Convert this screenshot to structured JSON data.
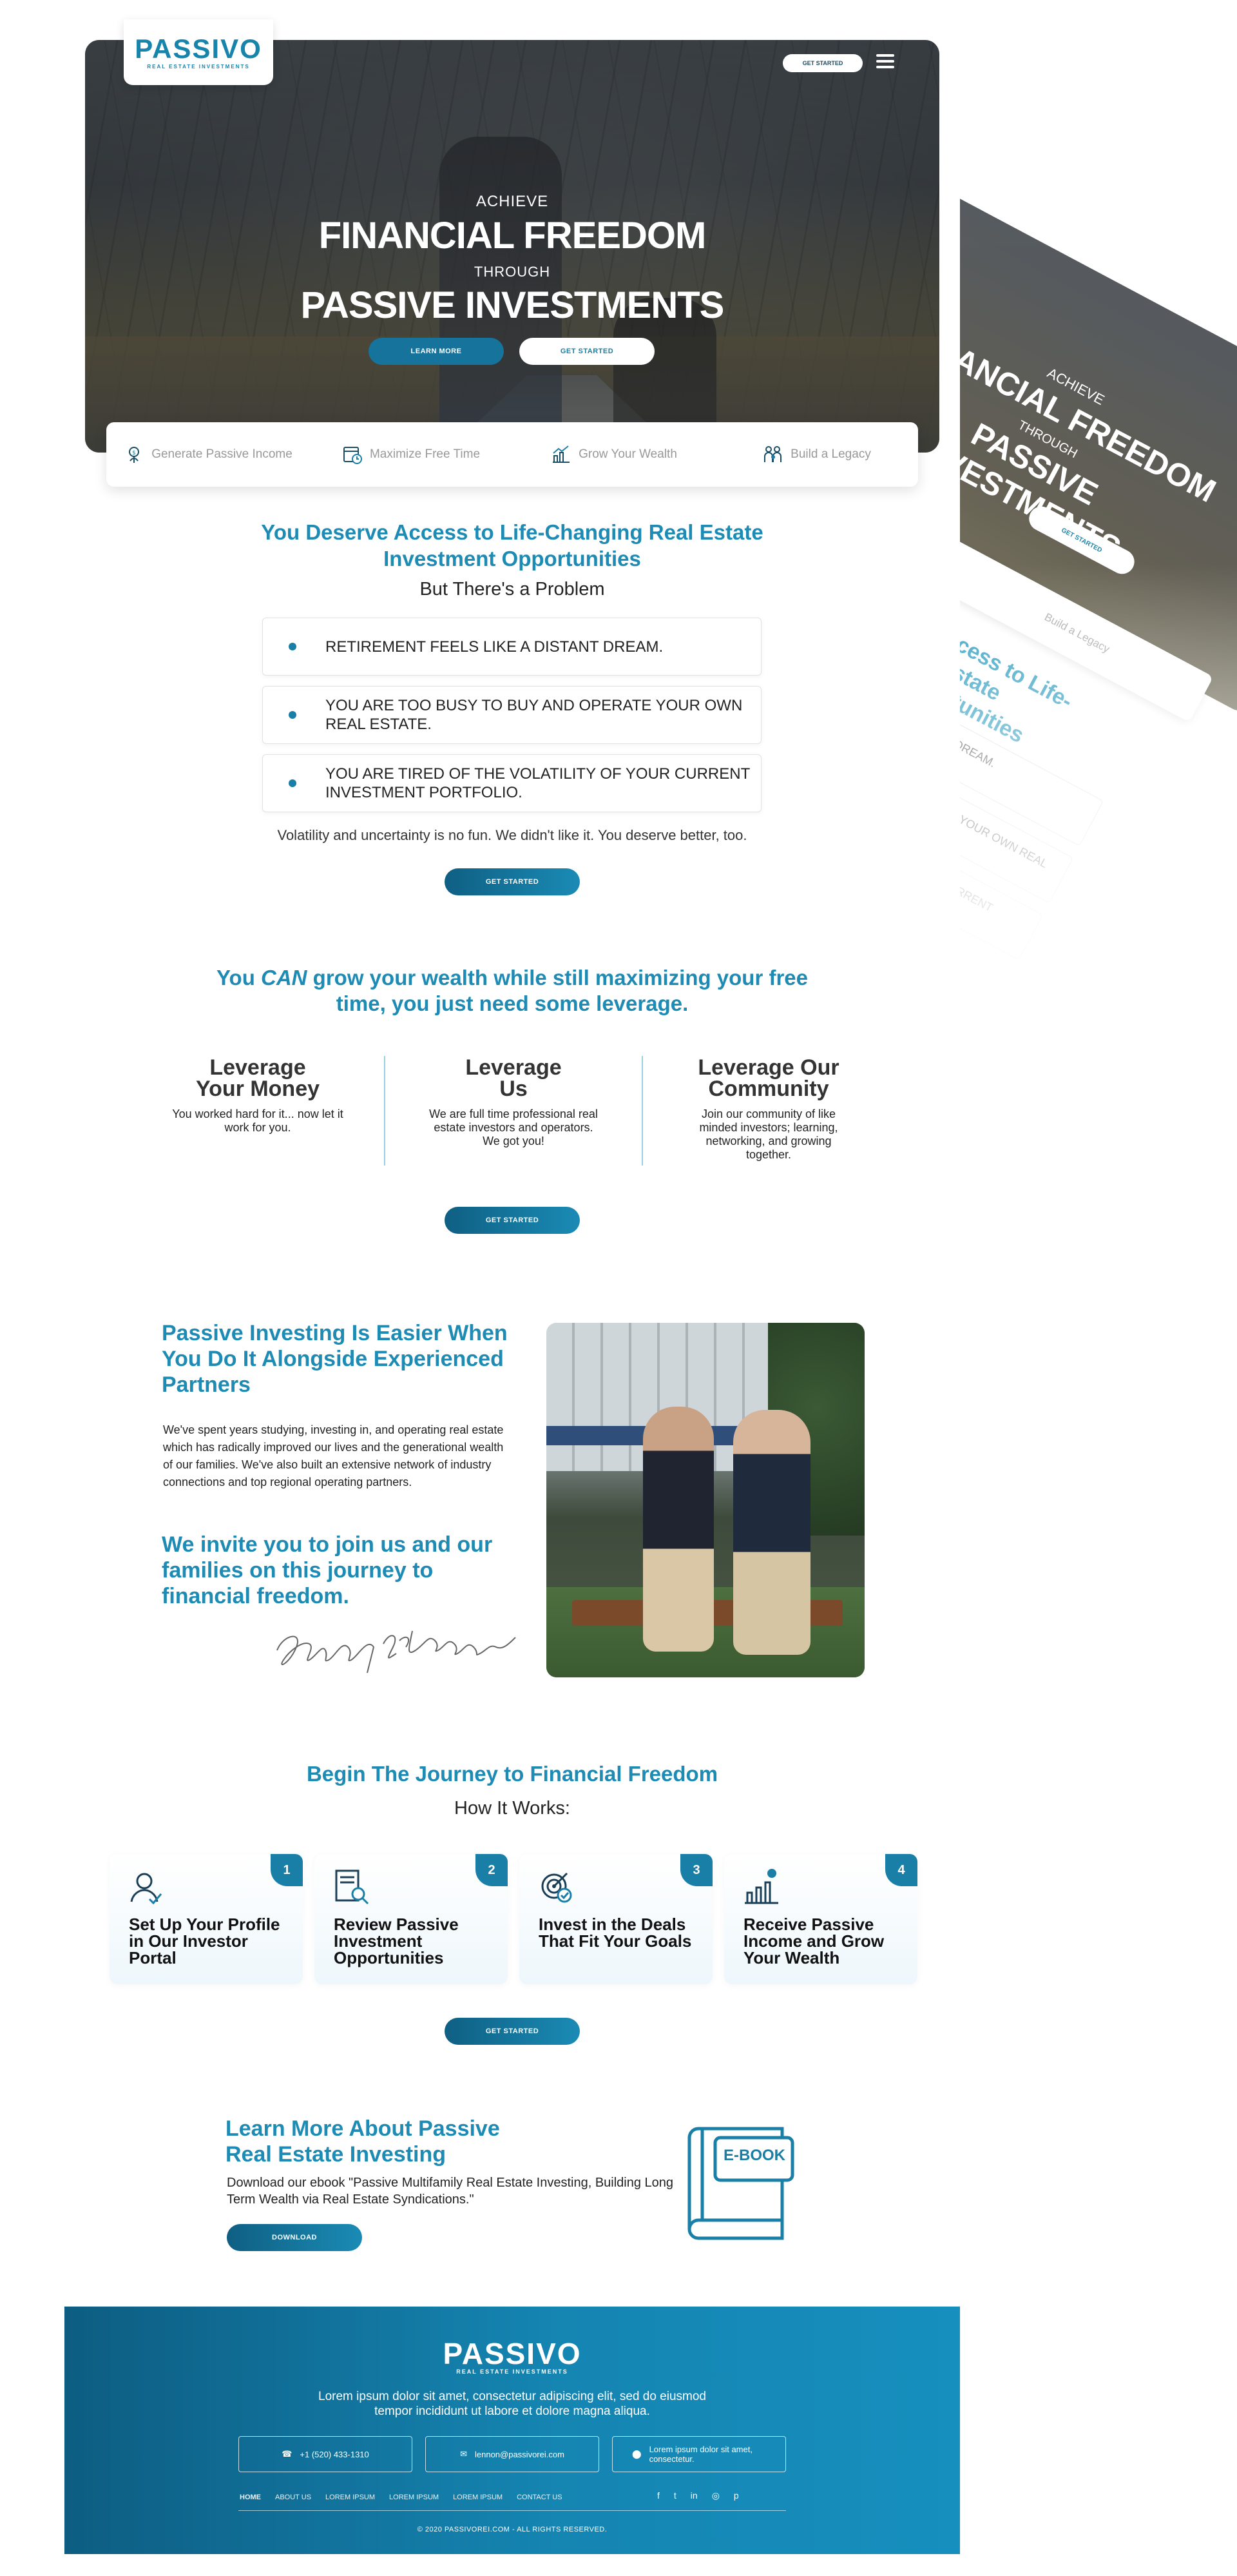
{
  "brand": {
    "logo": "PASSIVO",
    "tagline": "REAL ESTATE INVESTMENTS",
    "accent": "#1a7fa6"
  },
  "hero": {
    "top_button": "GET STARTED",
    "line1": "ACHIEVE",
    "line2": "FINANCIAL FREEDOM",
    "line3": "THROUGH",
    "line4": "PASSIVE INVESTMENTS",
    "btn_learn": "LEARN MORE",
    "btn_start": "GET STARTED"
  },
  "features": [
    {
      "label": "Generate Passive Income",
      "icon": "money-plant-icon"
    },
    {
      "label": "Maximize Free Time",
      "icon": "calendar-clock-icon"
    },
    {
      "label": "Grow Your Wealth",
      "icon": "growth-chart-icon"
    },
    {
      "label": "Build a Legacy",
      "icon": "family-icon"
    }
  ],
  "problem": {
    "title": "You Deserve Access to Life-Changing Real Estate Investment Opportunities",
    "subtitle": "But There's a Problem",
    "items": [
      "RETIREMENT FEELS LIKE A DISTANT DREAM.",
      "YOU ARE TOO BUSY TO BUY AND OPERATE YOUR OWN REAL ESTATE.",
      "YOU ARE TIRED OF THE VOLATILITY OF YOUR CURRENT INVESTMENT PORTFOLIO."
    ],
    "note": "Volatility and uncertainty is no fun.  We didn't like it.  You deserve better, too.",
    "button": "GET STARTED"
  },
  "leverage": {
    "title_pre": "You ",
    "title_em": "CAN",
    "title_post": " grow your wealth while still maximizing your free time,  you just need some leverage.",
    "columns": [
      {
        "heading": "Leverage Your Money",
        "text": "You worked hard for it... now let it work for you."
      },
      {
        "heading": "Leverage Us",
        "text": "We are full time professional real estate investors and operators. We got you!"
      },
      {
        "heading": "Leverage Our Community",
        "text": "Join our community of like minded investors; learning, networking, and growing together."
      }
    ],
    "button": "GET STARTED"
  },
  "partners": {
    "title": "Passive Investing Is Easier When You Do It Alongside Experienced Partners",
    "text": "We've spent years studying, investing in, and operating real estate which has radically improved our lives and the generational wealth of our families. We've also built an extensive network of industry connections and top regional operating partners.",
    "invite": "We invite you to join us and our families on this journey to financial freedom.",
    "signature": "Stony & Lennon"
  },
  "how": {
    "title": "Begin The Journey to Financial Freedom",
    "subtitle": "How It Works:",
    "steps": [
      {
        "num": "1",
        "label": "Set Up Your Profile in Our Investor Portal",
        "icon": "user-profile-icon"
      },
      {
        "num": "2",
        "label": "Review Passive Investment Opportunities",
        "icon": "document-search-icon"
      },
      {
        "num": "3",
        "label": "Invest in the Deals That Fit Your Goals",
        "icon": "target-icon"
      },
      {
        "num": "4",
        "label": "Receive Passive Income and Grow Your Wealth",
        "icon": "income-chart-icon"
      }
    ],
    "button": "GET STARTED"
  },
  "ebook": {
    "title": "Learn More About Passive Real Estate Investing",
    "text": "Download our ebook \"Passive Multifamily Real Estate Investing, Building Long Term Wealth via Real Estate Syndications.\"",
    "button": "DOWNLOAD",
    "badge": "E-BOOK"
  },
  "footer": {
    "lorem": "Lorem ipsum dolor sit amet, consectetur adipiscing elit, sed do eiusmod tempor incididunt ut labore et dolore magna aliqua.",
    "phone": "+1 (520) 433-1310",
    "email": "lennon@passivorei.com",
    "address": "Lorem ipsum dolor sit amet, consectetur.",
    "nav": [
      "HOME",
      "ABOUT US",
      "LOREM IPSUM",
      "LOREM IPSUM",
      "LOREM IPSUM",
      "CONTACT US"
    ],
    "social": [
      "facebook-icon",
      "twitter-icon",
      "linkedin-icon",
      "instagram-icon",
      "pinterest-icon"
    ],
    "copyright": "© 2020 PASSIVOREI.COM - ALL RIGHTS RESERVED.",
    "bg": "#1585b2"
  }
}
